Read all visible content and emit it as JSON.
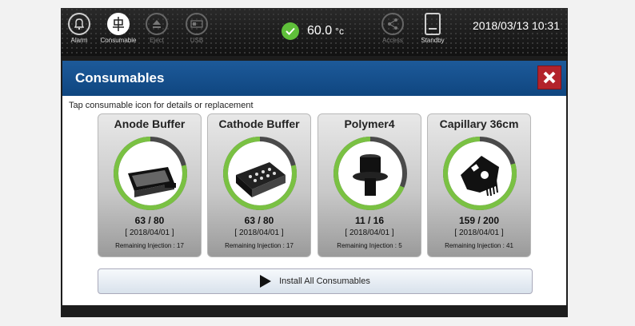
{
  "topbar": {
    "alarm_label": "Alarm",
    "consumable_label": "Consumable",
    "eject_label": "Eject",
    "usb_label": "USB",
    "temperature_value": "60.0",
    "temperature_unit": "°c",
    "access_label": "Access",
    "standby_label": "Standby",
    "datetime": "2018/03/13 10:31"
  },
  "dialog": {
    "title": "Consumables",
    "instruction": "Tap consumable icon for details or replacement",
    "install_label": "Install All Consumables"
  },
  "consumables": [
    {
      "title": "Anode Buffer",
      "count": "63 / 80",
      "remaining_fraction": 0.7875,
      "date": "[ 2018/04/01 ]",
      "remaining": "Remaining Injection : 17",
      "icon": "anode-tray-icon"
    },
    {
      "title": "Cathode Buffer",
      "count": "63 / 80",
      "remaining_fraction": 0.7875,
      "date": "[ 2018/04/01 ]",
      "remaining": "Remaining Injection : 17",
      "icon": "cathode-tray-icon"
    },
    {
      "title": "Polymer4",
      "count": "11 / 16",
      "remaining_fraction": 0.6875,
      "date": "[ 2018/04/01 ]",
      "remaining": "Remaining Injection : 5",
      "icon": "polymer-bottle-icon"
    },
    {
      "title": "Capillary 36cm",
      "count": "159 / 200",
      "remaining_fraction": 0.795,
      "date": "[ 2018/04/01 ]",
      "remaining": "Remaining Injection : 41",
      "icon": "capillary-array-icon"
    }
  ],
  "colors": {
    "ring_used": "#7ac143",
    "ring_track": "#4a4a4a",
    "header_blue": "#1a5592",
    "close_red": "#b3232b"
  }
}
